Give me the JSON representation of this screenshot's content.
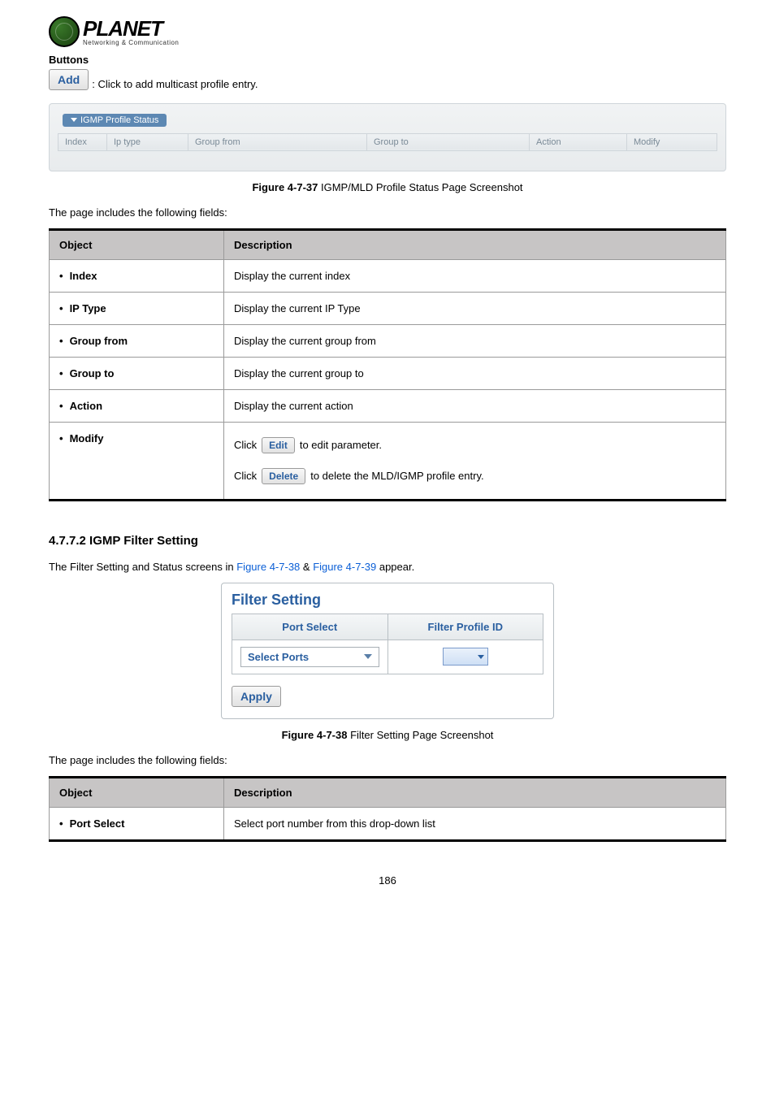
{
  "logo": {
    "name": "PLANET",
    "tagline": "Networking & Communication"
  },
  "buttons_heading": "Buttons",
  "add_button": {
    "label": "Add",
    "desc": ": Click to add multicast profile entry."
  },
  "status_panel": {
    "title": "IGMP Profile Status",
    "headers": [
      "Index",
      "Ip type",
      "Group from",
      "Group to",
      "Action",
      "Modify"
    ]
  },
  "fig37": {
    "label": "Figure 4-7-37",
    "text": " IGMP/MLD Profile Status Page Screenshot"
  },
  "fields_intro": "The page includes the following fields:",
  "table1": {
    "head": {
      "c1": "Object",
      "c2": "Description"
    },
    "rows": [
      {
        "obj": "Index",
        "desc": "Display the current index"
      },
      {
        "obj": "IP Type",
        "desc": "Display the current IP Type"
      },
      {
        "obj": "Group from",
        "desc": "Display the current group from"
      },
      {
        "obj": "Group to",
        "desc": "Display the current group to"
      },
      {
        "obj": "Action",
        "desc": "Display the current action"
      }
    ],
    "modify": {
      "obj": "Modify",
      "click": "Click",
      "edit_btn": "Edit",
      "edit_suffix": " to edit parameter.",
      "delete_btn": "Delete",
      "delete_suffix": " to delete the MLD/IGMP profile entry."
    }
  },
  "section_4772": "4.7.7.2 IGMP Filter Setting",
  "filter_intro": {
    "pre": "The Filter Setting and Status screens in ",
    "link1": "Figure 4-7-38",
    "amp": " & ",
    "link2": "Figure 4-7-39",
    "post": " appear."
  },
  "filter_card": {
    "title": "Filter Setting",
    "h1": "Port Select",
    "h2": "Filter Profile ID",
    "select_ports": "Select Ports",
    "apply": "Apply"
  },
  "fig38": {
    "label": "Figure 4-7-38",
    "text": " Filter Setting Page Screenshot"
  },
  "table2": {
    "head": {
      "c1": "Object",
      "c2": "Description"
    },
    "rows": [
      {
        "obj": "Port Select",
        "desc": "Select port number from this drop-down list"
      }
    ]
  },
  "page_number": "186"
}
